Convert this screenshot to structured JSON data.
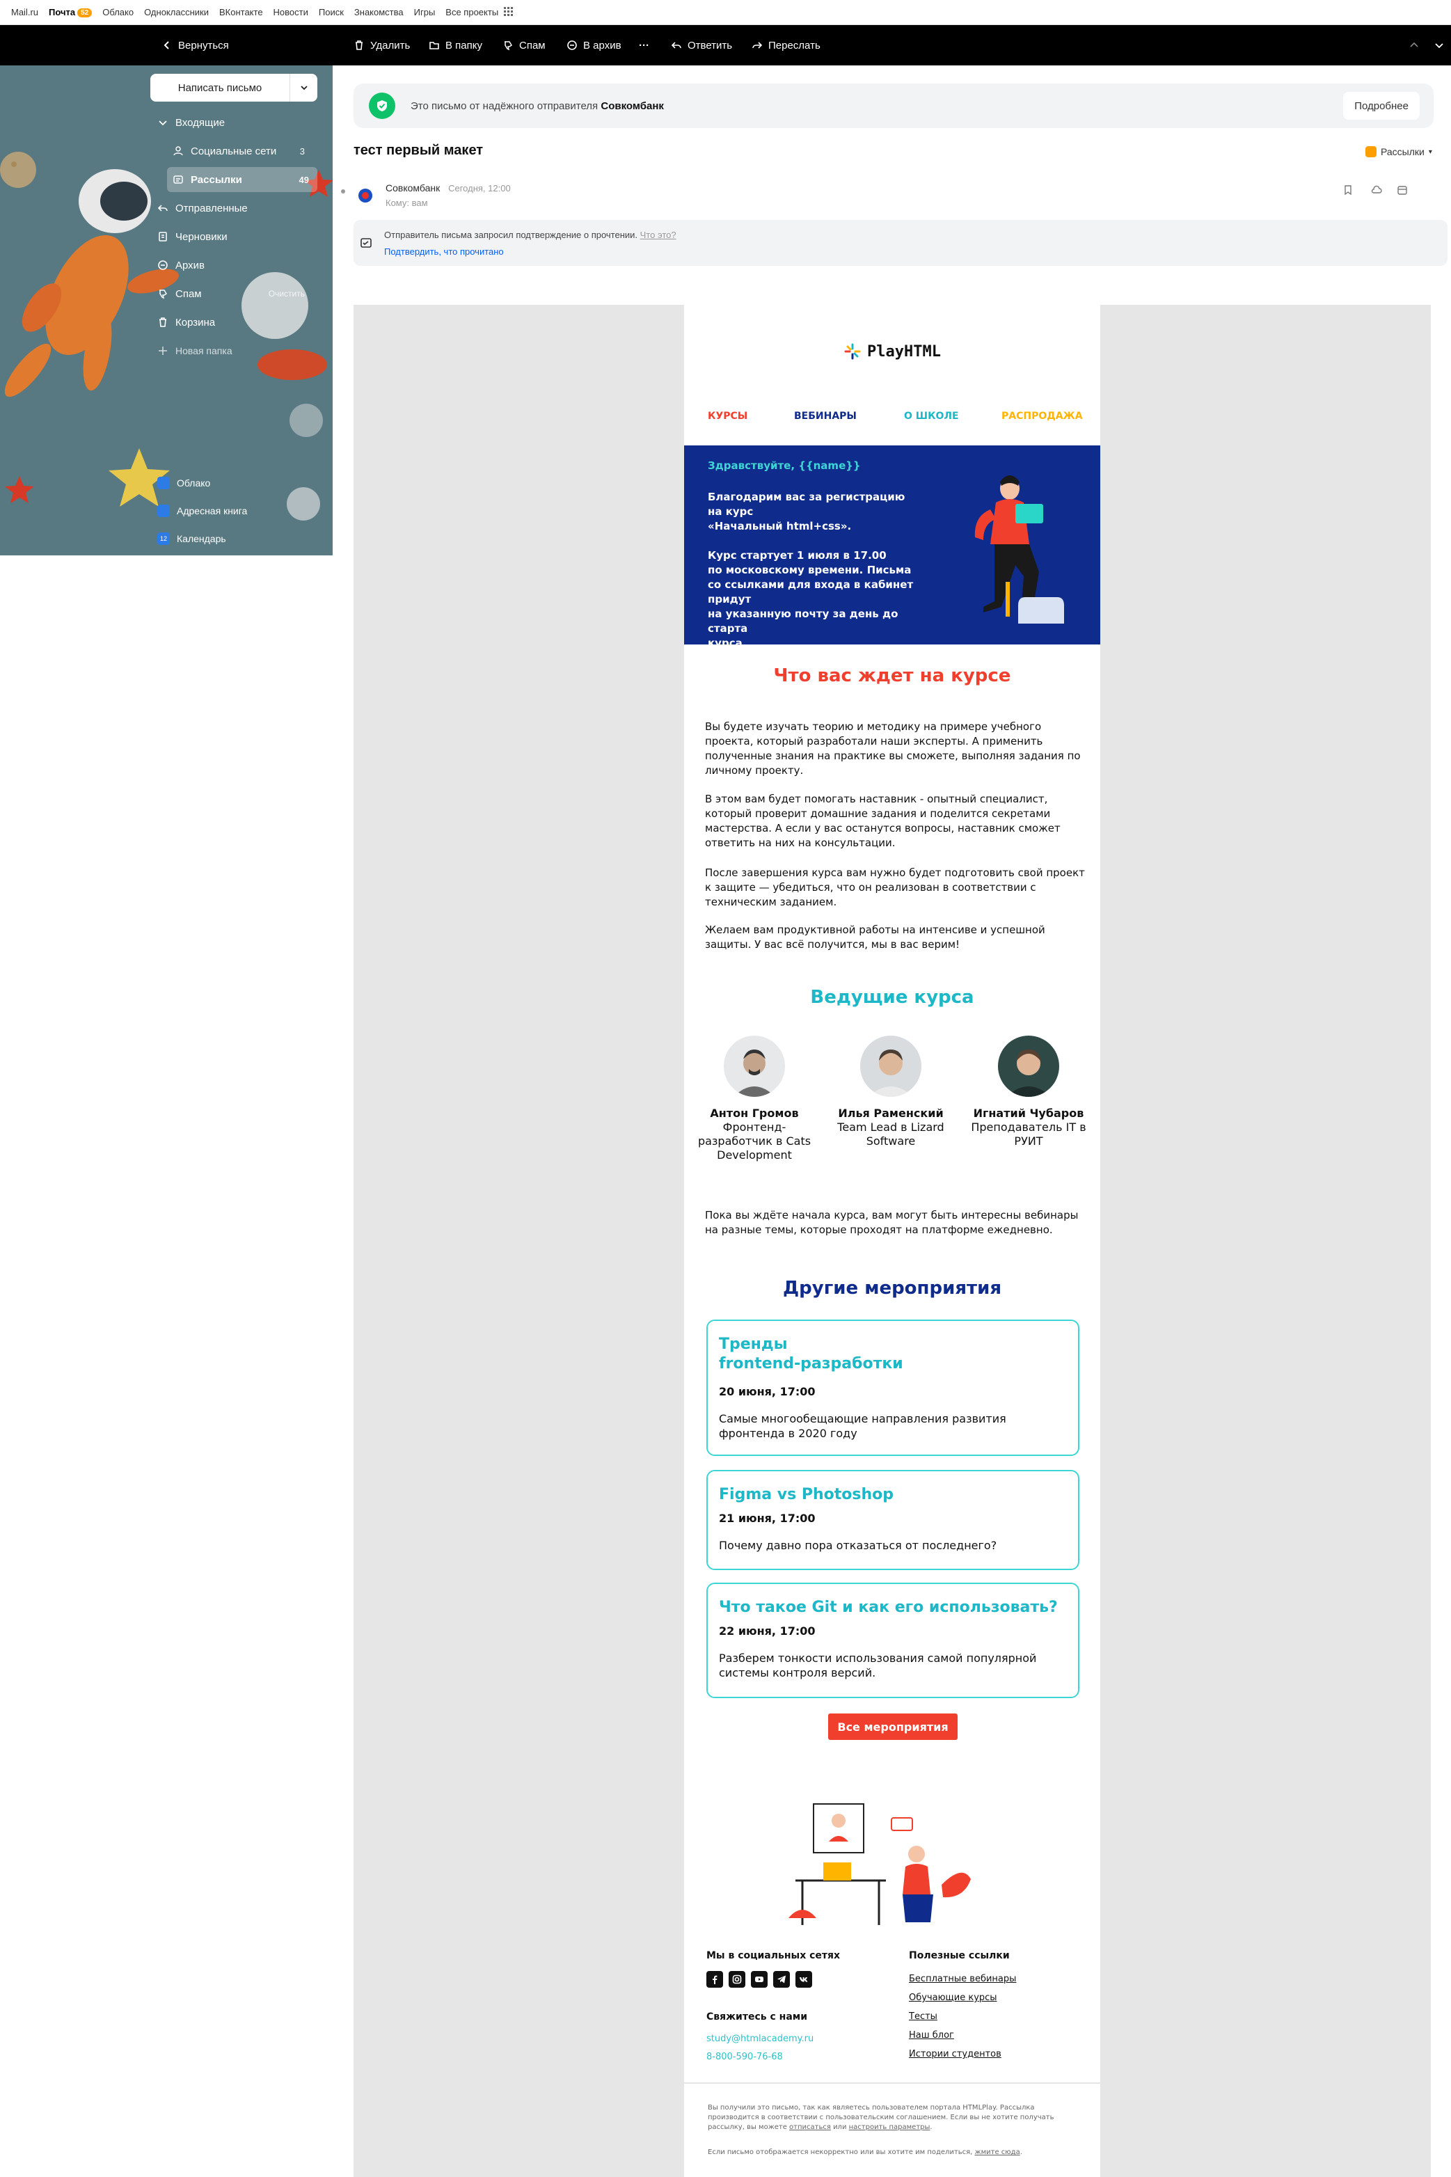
{
  "portal": {
    "links": [
      "Mail.ru",
      "Почта",
      "Облако",
      "Одноклассники",
      "ВКонтакте",
      "Новости",
      "Поиск",
      "Знакомства",
      "Игры",
      "Все проекты"
    ],
    "mail_badge": "52"
  },
  "toolbar": {
    "back": "Вернуться",
    "delete": "Удалить",
    "to_folder": "В папку",
    "spam": "Спам",
    "archive": "В архив",
    "more": "···",
    "reply": "Ответить",
    "forward": "Переслать"
  },
  "sidebar": {
    "compose": "Написать письмо",
    "folders": [
      {
        "label": "Входящие",
        "count": ""
      },
      {
        "label": "Социальные сети",
        "count": "3"
      },
      {
        "label": "Рассылки",
        "count": "49"
      },
      {
        "label": "Отправленные",
        "count": ""
      },
      {
        "label": "Черновики",
        "count": ""
      },
      {
        "label": "Архив",
        "count": ""
      },
      {
        "label": "Спам",
        "count": "Очистить"
      },
      {
        "label": "Корзина",
        "count": ""
      }
    ],
    "new_folder": "Новая папка",
    "apps": [
      "Облако",
      "Адресная книга",
      "Календарь"
    ],
    "calendar_day": "12"
  },
  "notice": {
    "text": "Это письмо от надёжного отправителя",
    "sender": "Совкомбанк",
    "button": "Подробнее"
  },
  "letter": {
    "subject": "тест первый макет",
    "tag": "Рассылки",
    "from": "Совкомбанк",
    "date": "Сегодня, 12:00",
    "to": "Кому: вам",
    "receipt_text": "Отправитель письма запросил подтверждение о прочтении.",
    "receipt_what": "Что это?",
    "receipt_confirm": "Подтвердить, что прочитано"
  },
  "email": {
    "logo": "PlayHTML",
    "nav": [
      {
        "label": "КУРСЫ",
        "color": "#f0402d"
      },
      {
        "label": "ВЕБИНАРЫ",
        "color": "#0f2c8c"
      },
      {
        "label": "О ШКОЛЕ",
        "color": "#1cb8c7"
      },
      {
        "label": "РАСПРОДАЖА",
        "color": "#ffb400"
      }
    ],
    "hero_greeting": "Здравствуйте, {{name}}",
    "hero_text": "Благодарим вас за регистрацию на курс\n«Начальный html+css».\n\nКурс стартует 1 июля в 17.00\nпо московскому времени. Письма\nсо ссылками для входа в кабинет придут\nна указанную почту за день до старта\nкурса.",
    "what_title": "Что вас ждет на курсе",
    "paragraphs": [
      "Вы будете изучать теорию и методику на примере учебного проекта, который разработали наши эксперты. А применить полученные знания на практике вы сможете, выполняя задания по личному проекту.",
      "В этом вам будет помогать наставник - опытный специалист, который проверит домашние задания и поделится секретами мастерства. А если у вас останутся вопросы, наставник сможет ответить на них на консультации.",
      "После завершения курса вам нужно будет подготовить свой проект к защите — убедиться, что он реализован в соответствии с техническим заданием.",
      "Желаем вам продуктивной работы на интенсиве и успешной защиты. У вас всё получится, мы в вас верим!"
    ],
    "teachers_title": "Ведущие курса",
    "teachers": [
      {
        "name": "Антон Громов",
        "role": "Фронтенд-разработчик в Cats Development"
      },
      {
        "name": "Илья Раменский",
        "role": "Team Lead в Lizard Software"
      },
      {
        "name": "Игнатий Чубаров",
        "role": "Преподаватель IT в РУИТ"
      }
    ],
    "wait_text": "Пока вы ждёте начала курса, вам могут быть интересны вебинары на разные темы, которые проходят на платформе ежедневно.",
    "events_title": "Другие мероприятия",
    "events": [
      {
        "title": "Тренды\nfrontend-разработки",
        "date": "20 июня, 17:00",
        "desc": "Самые многообещающие направления развития фронтенда в 2020 году"
      },
      {
        "title": "Figma vs Photoshop",
        "date": "21 июня, 17:00",
        "desc": "Почему давно пора отказаться от последнего?"
      },
      {
        "title": "Что такое Git и как его использовать?",
        "date": "22 июня, 17:00",
        "desc": "Разберем тонкости использования самой популярной системы контроля версий."
      }
    ],
    "all_events": "Все мероприятия",
    "social_title": "Мы в социальных сетях",
    "contact_title": "Свяжитесь с нами",
    "contact_email": "study@htmlacademy.ru",
    "contact_phone": "8-800-590-76-68",
    "links_title": "Полезные ссылки",
    "links": [
      "Бесплатные вебинары",
      "Обучающие курсы",
      "Тесты",
      "Наш блог",
      "Истории студентов"
    ],
    "legal_1": "Вы получили это письмо, так как являетесь пользователем портала HTMLPlay. Рассылка производится в соответствии с пользовательским соглашением. Если вы не хотите получать рассылку, вы можете",
    "legal_unsub": "отписаться",
    "legal_or": "или",
    "legal_settings": "настроить параметры",
    "legal_2": "Если письмо отображается некорректно или вы хотите им поделиться,",
    "legal_here": "жмите сюда"
  },
  "colors": {
    "accent_red": "#f0402d",
    "accent_blue": "#0f2c8c",
    "accent_teal": "#1cb8c7",
    "sidebar": "#587981"
  }
}
